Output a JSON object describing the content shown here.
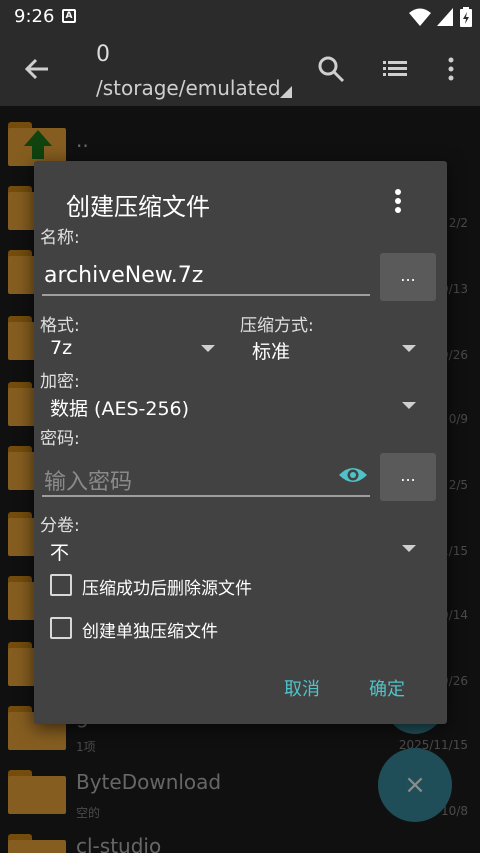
{
  "statusbar": {
    "time": "9:26",
    "badge": "A"
  },
  "appbar": {
    "title": "0",
    "path": "/storage/emulated"
  },
  "files": [
    {
      "name": "..",
      "sub": "",
      "date": ""
    },
    {
      "name": "",
      "sub": "",
      "date": "2/2"
    },
    {
      "name": "",
      "sub": "",
      "date": "0/13"
    },
    {
      "name": "",
      "sub": "",
      "date": "9/26"
    },
    {
      "name": "",
      "sub": "",
      "date": "0/9"
    },
    {
      "name": "",
      "sub": "",
      "date": "2/5"
    },
    {
      "name": "",
      "sub": "",
      "date": "1/15"
    },
    {
      "name": "",
      "sub": "",
      "date": "0/14"
    },
    {
      "name": "",
      "sub": "",
      "date": "9/26"
    },
    {
      "name": "g",
      "sub": "1项",
      "date": "2025/11/15"
    },
    {
      "name": "ByteDownload",
      "sub": "空的",
      "date": "10/8"
    },
    {
      "name": "cl-studio",
      "sub": "",
      "date": ""
    }
  ],
  "fab": {
    "label": "×"
  },
  "dialog": {
    "title": "创建压缩文件",
    "name_label": "名称:",
    "name_value": "archiveNew.7z",
    "browse_label": "...",
    "format_label": "格式:",
    "format_value": "7z",
    "method_label": "压缩方式:",
    "method_value": "标准",
    "encrypt_label": "加密:",
    "encrypt_value": "数据 (AES-256)",
    "password_label": "密码:",
    "password_placeholder": "输入密码",
    "password_browse_label": "...",
    "split_label": "分卷:",
    "split_value": "不",
    "delete_source_label": "压缩成功后删除源文件",
    "separate_archive_label": "创建单独压缩文件",
    "cancel_label": "取消",
    "ok_label": "确定"
  },
  "colors": {
    "accent": "#4fc3c8",
    "folder": "#f2a93b",
    "dialog_bg": "#424242",
    "fab": "#3a8ea0"
  }
}
